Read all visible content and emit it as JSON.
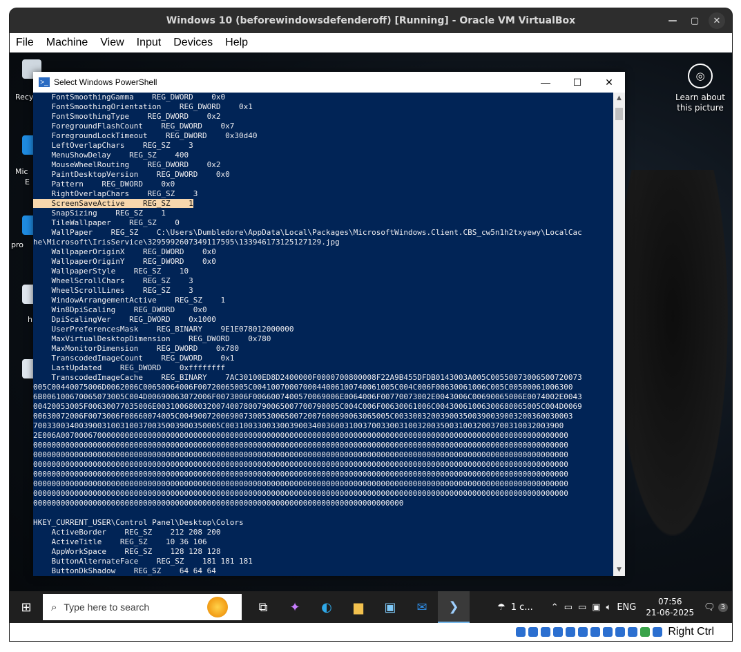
{
  "vbox": {
    "title": "Windows 10 (beforewindowsdefenderoff) [Running] - Oracle VM VirtualBox",
    "menu": [
      "File",
      "Machine",
      "View",
      "Input",
      "Devices",
      "Help"
    ],
    "controls": {
      "minimize": "—",
      "maximize": "▢",
      "close": "✕"
    },
    "host_key": "Right Ctrl"
  },
  "desktop": {
    "icon_labels": [
      "Recy",
      "Mic",
      "E",
      "pro",
      "h"
    ],
    "learn_label": "Learn about this picture"
  },
  "powershell": {
    "title": "Select Windows PowerShell",
    "controls": {
      "minimize": "—",
      "maximize": "☐",
      "close": "✕"
    },
    "highlighted_line": 11,
    "lines": [
      "    FontSmoothingGamma    REG_DWORD    0x0",
      "    FontSmoothingOrientation    REG_DWORD    0x1",
      "    FontSmoothingType    REG_DWORD    0x2",
      "    ForegroundFlashCount    REG_DWORD    0x7",
      "    ForegroundLockTimeout    REG_DWORD    0x30d40",
      "    LeftOverlapChars    REG_SZ    3",
      "    MenuShowDelay    REG_SZ    400",
      "    MouseWheelRouting    REG_DWORD    0x2",
      "    PaintDesktopVersion    REG_DWORD    0x0",
      "    Pattern    REG_DWORD    0x0",
      "    RightOverlapChars    REG_SZ    3",
      "    ScreenSaveActive    REG_SZ    1",
      "    SnapSizing    REG_SZ    1",
      "    TileWallpaper    REG_SZ    0",
      "    WallPaper    REG_SZ    C:\\Users\\Dumbledore\\AppData\\Local\\Packages\\MicrosoftWindows.Client.CBS_cw5n1h2txyewy\\LocalCac",
      "he\\Microsoft\\IrisService\\3295992607349117595\\133946173125127129.jpg",
      "    WallpaperOriginX    REG_DWORD    0x0",
      "    WallpaperOriginY    REG_DWORD    0x0",
      "    WallpaperStyle    REG_SZ    10",
      "    WheelScrollChars    REG_SZ    3",
      "    WheelScrollLines    REG_SZ    3",
      "    WindowArrangementActive    REG_SZ    1",
      "    Win8DpiScaling    REG_DWORD    0x0",
      "    DpiScalingVer    REG_DWORD    0x1000",
      "    UserPreferencesMask    REG_BINARY    9E1E078012000000",
      "    MaxVirtualDesktopDimension    REG_DWORD    0x780",
      "    MaxMonitorDimension    REG_DWORD    0x780",
      "    TranscodedImageCount    REG_DWORD    0x1",
      "    LastUpdated    REG_DWORD    0xffffffff",
      "    TranscodedImageCache    REG_BINARY    7AC30100ED8D2400000F0000700800008F22A9B455DFDB0143003A005C00550073006500720073",
      "005C00440075006D0062006C00650064006F00720065005C0041007000700044006100740061005C004C006F00630061006C005C00500061006300",
      "6B006100670065073005C004D00690063072006F0073006F0066007400570069006E0064006F00770073002E0043006C00690065006E0074002E0043",
      "00420053005F00630077035006E0031006800320074007800790065007700790005C004C006F00630061006C00430061006300680065005C004D0069",
      "00630072006F0073006F00660074005C0049007200690073005300650072007600690063065005C003300320039003500390039003200360030003",
      "70033003400390031003100370035003900350005C00310033003300390034003600310037003300310032003500310032003700310032003900",
      "2E006A007000670000000000000000000000000000000000000000000000000000000000000000000000000000000000000000000000000000000",
      "000000000000000000000000000000000000000000000000000000000000000000000000000000000000000000000000000000000000000000000",
      "000000000000000000000000000000000000000000000000000000000000000000000000000000000000000000000000000000000000000000000",
      "000000000000000000000000000000000000000000000000000000000000000000000000000000000000000000000000000000000000000000000",
      "000000000000000000000000000000000000000000000000000000000000000000000000000000000000000000000000000000000000000000000",
      "000000000000000000000000000000000000000000000000000000000000000000000000000000000000000000000000000000000000000000000",
      "000000000000000000000000000000000000000000000000000000000000000000000000000000000000000000000000000000000000000000000",
      "000000000000000000000000000000000000000000000000000000000000000000000000000000000",
      "",
      "HKEY_CURRENT_USER\\Control Panel\\Desktop\\Colors",
      "    ActiveBorder    REG_SZ    212 208 200",
      "    ActiveTitle    REG_SZ    10 36 106",
      "    AppWorkSpace    REG_SZ    128 128 128",
      "    ButtonAlternateFace    REG_SZ    181 181 181",
      "    ButtonDkShadow    REG_SZ    64 64 64"
    ]
  },
  "taskbar": {
    "search_placeholder": "Type here to search",
    "weather": "1 c...",
    "language": "ENG",
    "time": "07:56",
    "date": "21-06-2025",
    "notification_count": "3"
  },
  "colors": {
    "console_bg": "#012456",
    "console_fg": "#eeedf0",
    "highlight": "#f7d7ad"
  }
}
